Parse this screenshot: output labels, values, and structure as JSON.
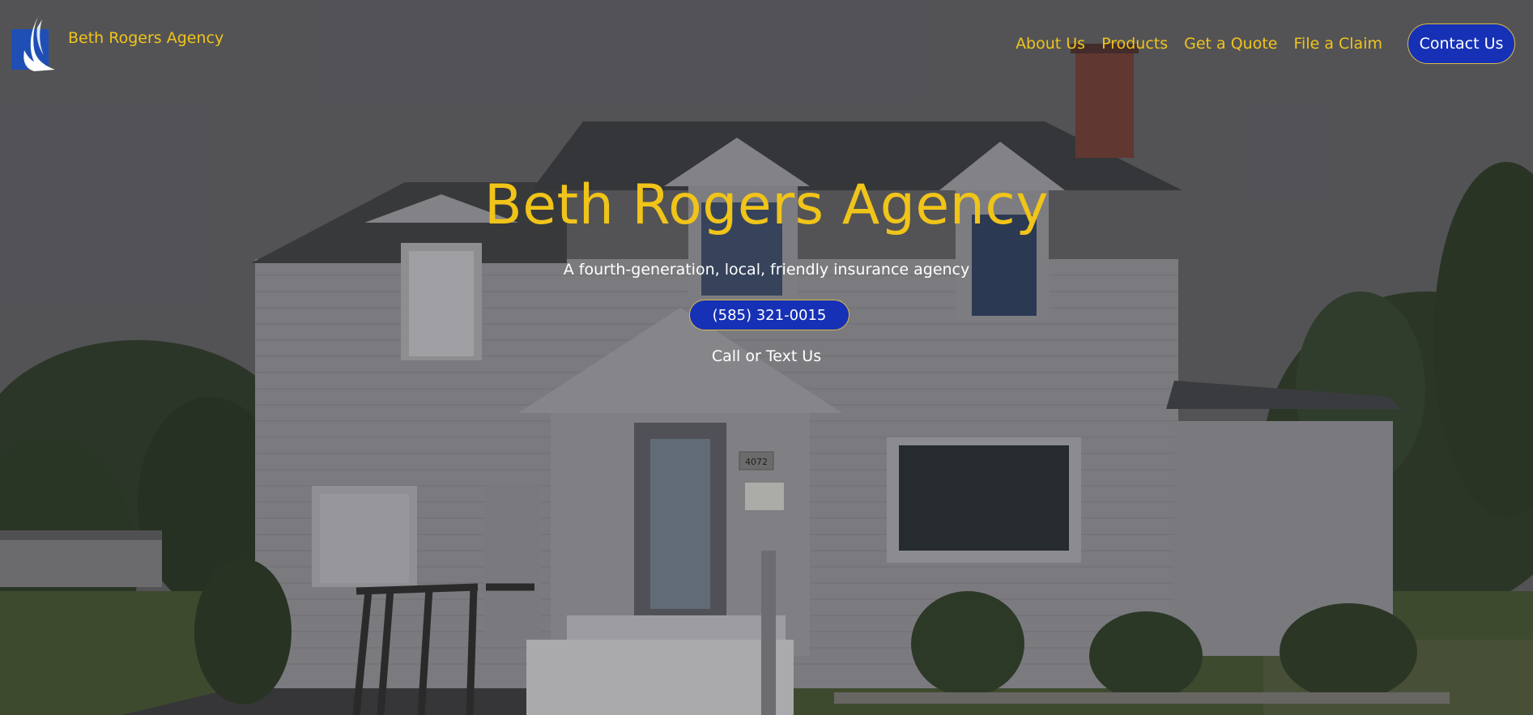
{
  "header": {
    "brand_name": "Beth Rogers Agency",
    "logo_icon": "nationwide-eagle-logo-icon",
    "nav": [
      {
        "label": "About Us"
      },
      {
        "label": "Products"
      },
      {
        "label": "Get a Quote"
      },
      {
        "label": "File a Claim"
      }
    ],
    "contact_label": "Contact Us"
  },
  "hero": {
    "title": "Beth Rogers Agency",
    "subtitle": "A fourth-generation, local, friendly insurance agency",
    "phone_label": "(585) 321-0015",
    "call_text": "Call or Text Us",
    "house_number": "4072"
  },
  "colors": {
    "accent_gold": "#f0c419",
    "button_blue": "#1631b5",
    "text_white": "#ffffff"
  }
}
